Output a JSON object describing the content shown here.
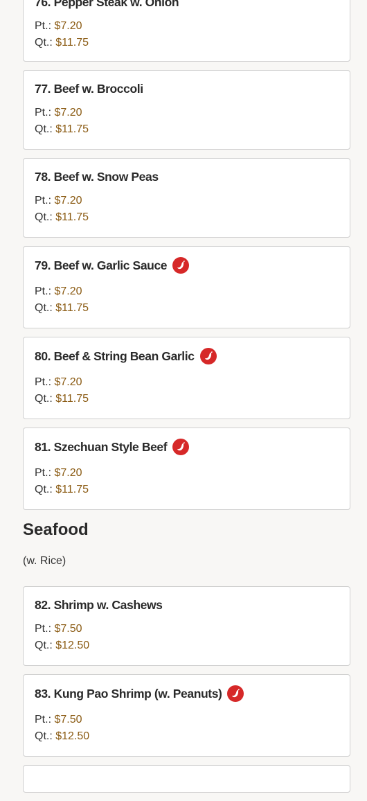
{
  "items_beef": [
    {
      "title": "76. Pepper Steak w. Onion",
      "spicy": false,
      "pt_label": "Pt.:",
      "pt": "$7.20",
      "qt_label": "Qt.:",
      "qt": "$11.75"
    },
    {
      "title": "77. Beef w. Broccoli",
      "spicy": false,
      "pt_label": "Pt.:",
      "pt": "$7.20",
      "qt_label": "Qt.:",
      "qt": "$11.75"
    },
    {
      "title": "78. Beef w. Snow Peas",
      "spicy": false,
      "pt_label": "Pt.:",
      "pt": "$7.20",
      "qt_label": "Qt.:",
      "qt": "$11.75"
    },
    {
      "title": "79. Beef w. Garlic Sauce",
      "spicy": true,
      "pt_label": "Pt.:",
      "pt": "$7.20",
      "qt_label": "Qt.:",
      "qt": "$11.75"
    },
    {
      "title": "80. Beef & String Bean Garlic",
      "spicy": true,
      "pt_label": "Pt.:",
      "pt": "$7.20",
      "qt_label": "Qt.:",
      "qt": "$11.75"
    },
    {
      "title": "81. Szechuan Style Beef",
      "spicy": true,
      "pt_label": "Pt.:",
      "pt": "$7.20",
      "qt_label": "Qt.:",
      "qt": "$11.75"
    }
  ],
  "seafood": {
    "title": "Seafood",
    "note": "(w. Rice)",
    "items": [
      {
        "title": "82. Shrimp w. Cashews",
        "spicy": false,
        "pt_label": "Pt.:",
        "pt": "$7.50",
        "qt_label": "Qt.:",
        "qt": "$12.50"
      },
      {
        "title": "83. Kung Pao Shrimp (w. Peanuts)",
        "spicy": true,
        "pt_label": "Pt.:",
        "pt": "$7.50",
        "qt_label": "Qt.:",
        "qt": "$12.50"
      }
    ]
  },
  "icons": {
    "spicy": "chili-pepper-icon"
  },
  "colors": {
    "price": "#8a5a12",
    "spicy_badge": "#d62828",
    "card_border": "#cfcfcf",
    "background": "#f8f7f5"
  }
}
